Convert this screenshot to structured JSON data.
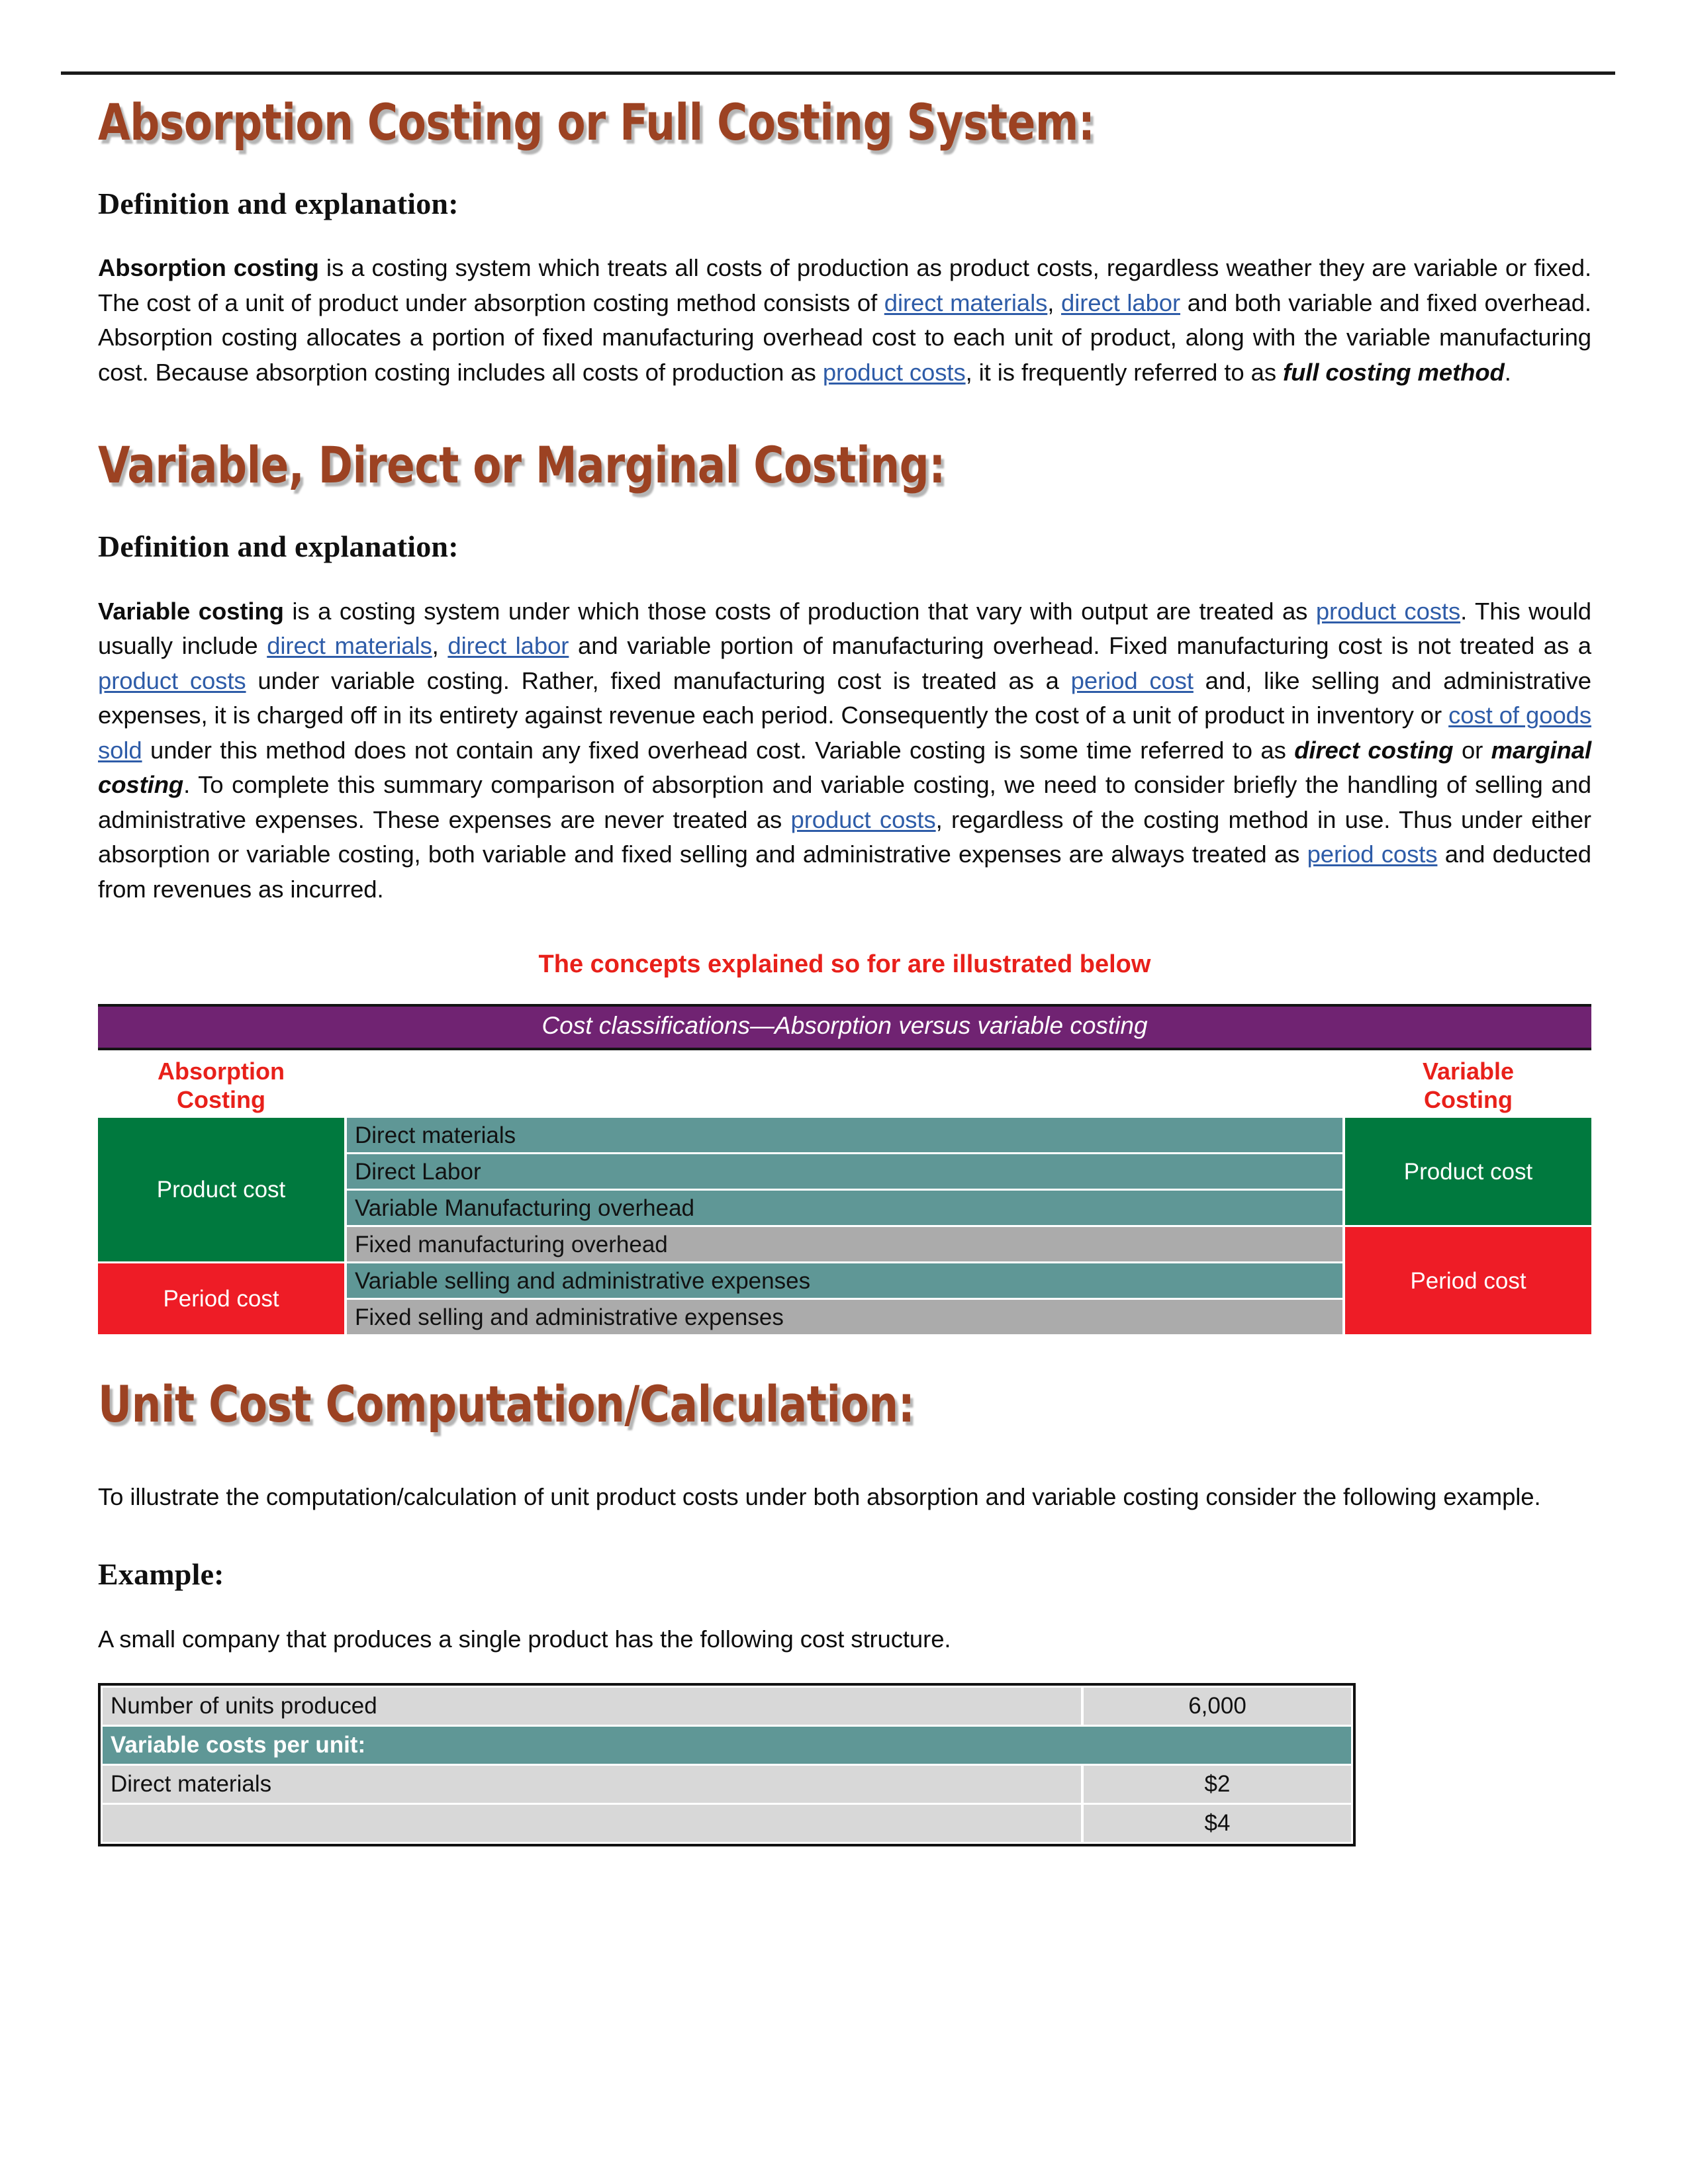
{
  "document": {
    "sections": {
      "absorption": {
        "heading": "Absorption Costing or Full Costing System:",
        "subheading": "Definition and explanation:",
        "paragraph": {
          "lead": "Absorption costing",
          "t1": " is a costing system which treats all costs of production as product costs, regardless weather they are variable or fixed. The cost of a unit of product under absorption costing method consists of ",
          "link1": "direct materials",
          "t2": ", ",
          "link2": "direct labor",
          "t3": " and both variable and fixed overhead. Absorption costing allocates a portion of fixed manufacturing overhead cost to each unit of product, along with the variable manufacturing cost. Because absorption costing includes all costs of production as ",
          "link3": "product costs",
          "t4": ", it is frequently referred to as ",
          "emph": "full costing method",
          "t5": "."
        }
      },
      "variable": {
        "heading": "Variable, Direct or Marginal Costing:",
        "subheading": "Definition and explanation:",
        "paragraph": {
          "lead": "Variable costing",
          "t1": " is a costing system under which those costs of production that vary with output are treated as ",
          "link1": "product costs",
          "t2": ". This would usually include ",
          "link2": "direct materials",
          "t3": ", ",
          "link3": "direct labor",
          "t4": " and variable portion of manufacturing overhead. Fixed manufacturing cost is not treated as a ",
          "link4": "product costs",
          "t5": " under variable costing. Rather, fixed manufacturing cost is treated as a ",
          "link5": "period cost",
          "t6": " and, like selling and administrative expenses, it is charged off in its entirety against revenue each period. Consequently the cost of a unit of product in inventory or ",
          "link6": "cost of goods sold",
          "t7": " under this method does not contain any fixed overhead cost. Variable costing is some time referred to as ",
          "emph1": "direct costing",
          "t8": " or ",
          "emph2": "marginal costing",
          "t9": ". To complete this summary comparison of absorption and variable costing, we need to consider briefly the handling of selling and administrative expenses. These expenses are never treated as ",
          "link7": "product costs",
          "t10": ", regardless of the costing method in use. Thus under either absorption or variable costing, both variable and fixed selling and administrative expenses are always treated as ",
          "link8": "period costs",
          "t11": " and deducted from revenues as incurred."
        }
      },
      "unit_cost": {
        "heading": "Unit Cost Computation/Calculation:",
        "paragraph": "To illustrate the computation/calculation of unit product costs under both absorption and variable costing consider the following example.",
        "example_heading": "Example:",
        "example_intro": "A small company that produces a single product has the following cost structure."
      }
    },
    "callout": "The concepts explained so for are illustrated below",
    "comparison_table": {
      "title": "Cost classifications—Absorption versus variable costing",
      "left_header": "Absorption\nCosting",
      "left_header_line1": "Absorption",
      "left_header_line2": "Costing",
      "right_header_line1": "Variable",
      "right_header_line2": "Costing",
      "absorption_groups": [
        {
          "label": "Product cost",
          "rows": 4,
          "color": "#00793E"
        },
        {
          "label": "Period cost",
          "rows": 2,
          "color": "#EE1C26"
        }
      ],
      "items": [
        {
          "label": "Direct materials",
          "color": "#5F9796"
        },
        {
          "label": "Direct Labor",
          "color": "#5F9796"
        },
        {
          "label": "Variable Manufacturing overhead",
          "color": "#5F9796"
        },
        {
          "label": "Fixed manufacturing overhead",
          "color": "#ABABAB"
        },
        {
          "label": "Variable selling and administrative expenses",
          "color": "#5F9796"
        },
        {
          "label": "Fixed selling and administrative expenses",
          "color": "#ABABAB"
        }
      ],
      "variable_groups": [
        {
          "label": "Product cost",
          "rows": 3,
          "color": "#00793E"
        },
        {
          "label": "Period cost",
          "rows": 3,
          "color": "#EE1C26"
        }
      ]
    },
    "cost_structure_table": {
      "rows": [
        {
          "label": "Number of units produced",
          "value": "6,000",
          "type": "data"
        },
        {
          "label": "Variable costs per unit:",
          "value": "",
          "type": "section"
        },
        {
          "label": "Direct materials",
          "value": "$2",
          "type": "data"
        },
        {
          "label": "",
          "value": "$4",
          "type": "data"
        }
      ]
    },
    "colors": {
      "heading": "#9C4222",
      "callout_red": "#E8201A",
      "title_purple": "#702372",
      "product_green": "#00793E",
      "period_red": "#EE1C26",
      "variable_teal": "#5F9796",
      "fixed_gray": "#ABABAB",
      "table_gray": "#D8D8D8",
      "link_blue": "#2E5CA8"
    }
  }
}
